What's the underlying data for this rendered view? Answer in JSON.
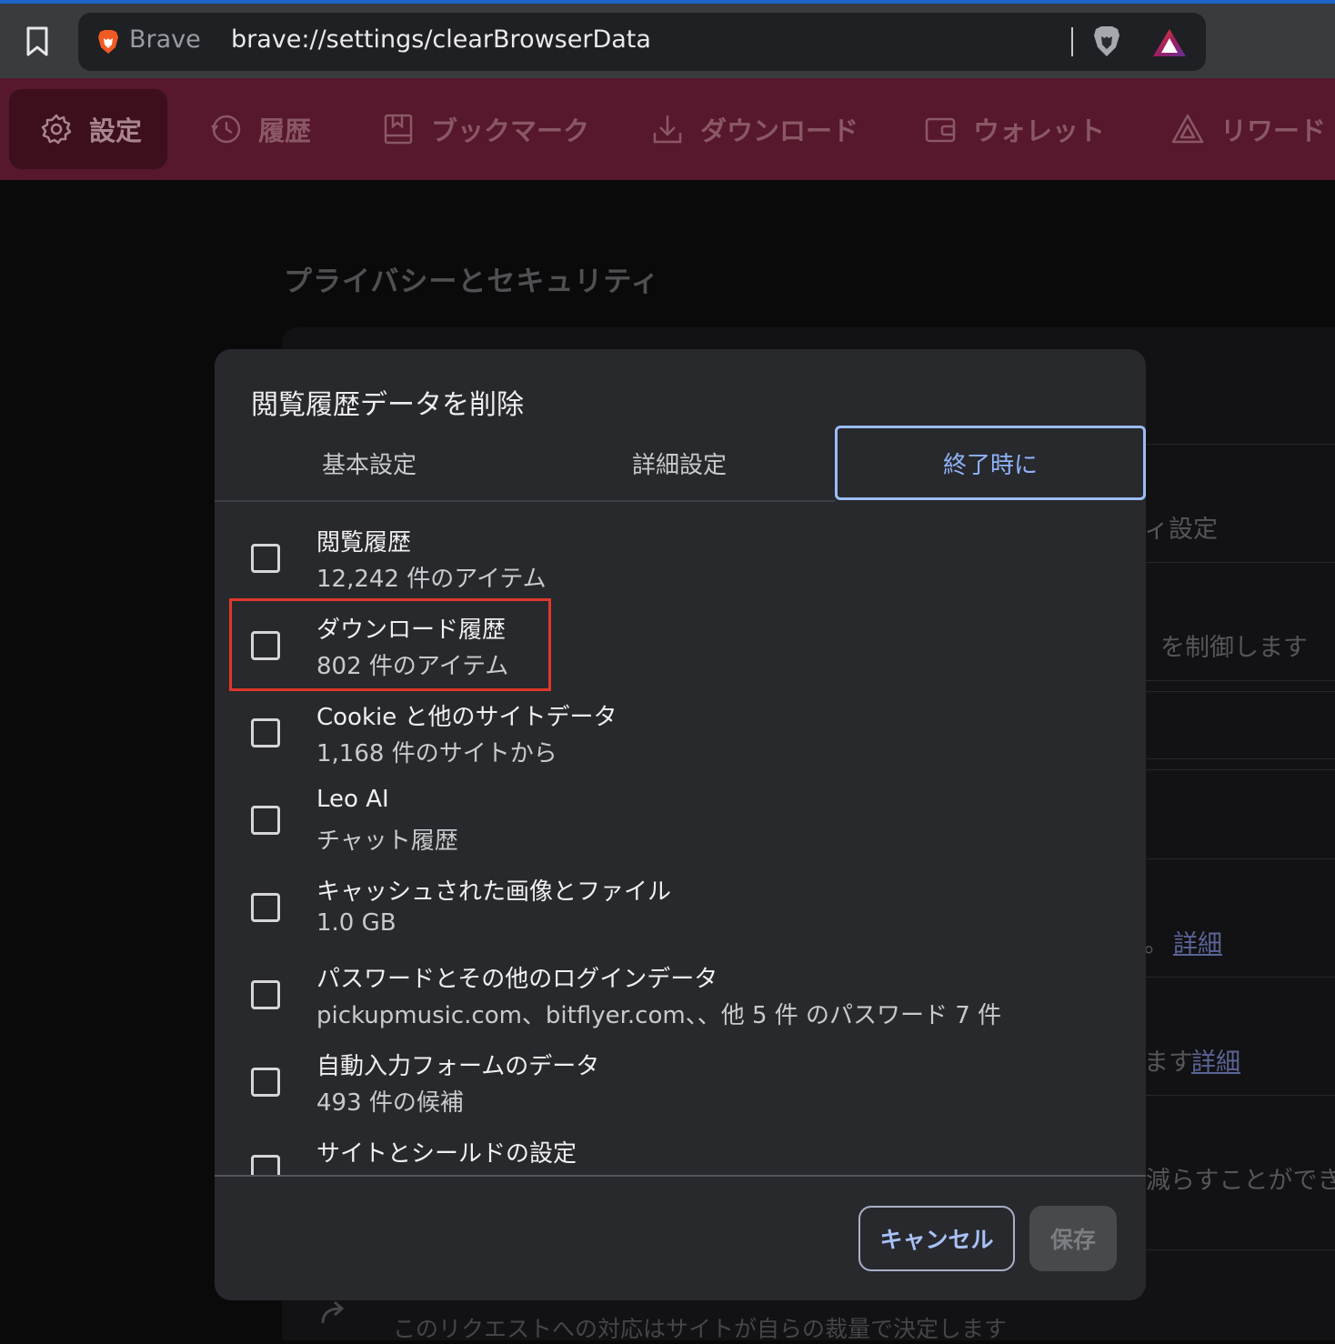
{
  "browser": {
    "brand": "Brave",
    "url": "brave://settings/clearBrowserData"
  },
  "nav": {
    "items": [
      {
        "label": "設定",
        "icon": "gear-icon"
      },
      {
        "label": "履歴",
        "icon": "history-icon"
      },
      {
        "label": "ブックマーク",
        "icon": "bookmark-icon"
      },
      {
        "label": "ダウンロード",
        "icon": "download-icon"
      },
      {
        "label": "ウォレット",
        "icon": "wallet-icon"
      },
      {
        "label": "リワード",
        "icon": "rewards-icon"
      }
    ]
  },
  "page": {
    "heading": "プライバシーとセキュリティ",
    "bg_fragments": [
      "ィ設定",
      "を制御します",
      "。",
      "詳細",
      "ます",
      "詳細",
      "減らすことができ"
    ],
    "bottom_text": "このリクエストへの対応はサイトが自らの裁量で決定します"
  },
  "dialog": {
    "title": "閲覧履歴データを削除",
    "tabs": [
      {
        "label": "基本設定"
      },
      {
        "label": "詳細設定"
      },
      {
        "label": "終了時に",
        "selected": true
      }
    ],
    "items": [
      {
        "title": "閲覧履歴",
        "subtitle": "12,242 件のアイテム",
        "checked": false
      },
      {
        "title": "ダウンロード履歴",
        "subtitle": "802 件のアイテム",
        "checked": false
      },
      {
        "title": "Cookie と他のサイトデータ",
        "subtitle": "1,168 件のサイトから",
        "checked": false
      },
      {
        "title": "Leo AI",
        "subtitle": "チャット履歴",
        "checked": false
      },
      {
        "title": "キャッシュされた画像とファイル",
        "subtitle": "1.0 GB",
        "checked": false
      },
      {
        "title": "パスワードとその他のログインデータ",
        "subtitle": "pickupmusic.com、bitflyer.com、、他 5 件 のパスワード 7 件",
        "checked": false
      },
      {
        "title": "自動入力フォームのデータ",
        "subtitle": "493 件の候補",
        "checked": false
      },
      {
        "title": "サイトとシールドの設定",
        "subtitle": "",
        "checked": false
      }
    ],
    "cancel_label": "キャンセル",
    "save_label": "保存"
  },
  "colors": {
    "nav_bg": "#57172c",
    "accent": "#8fb3f9",
    "highlight": "#e0372c"
  }
}
